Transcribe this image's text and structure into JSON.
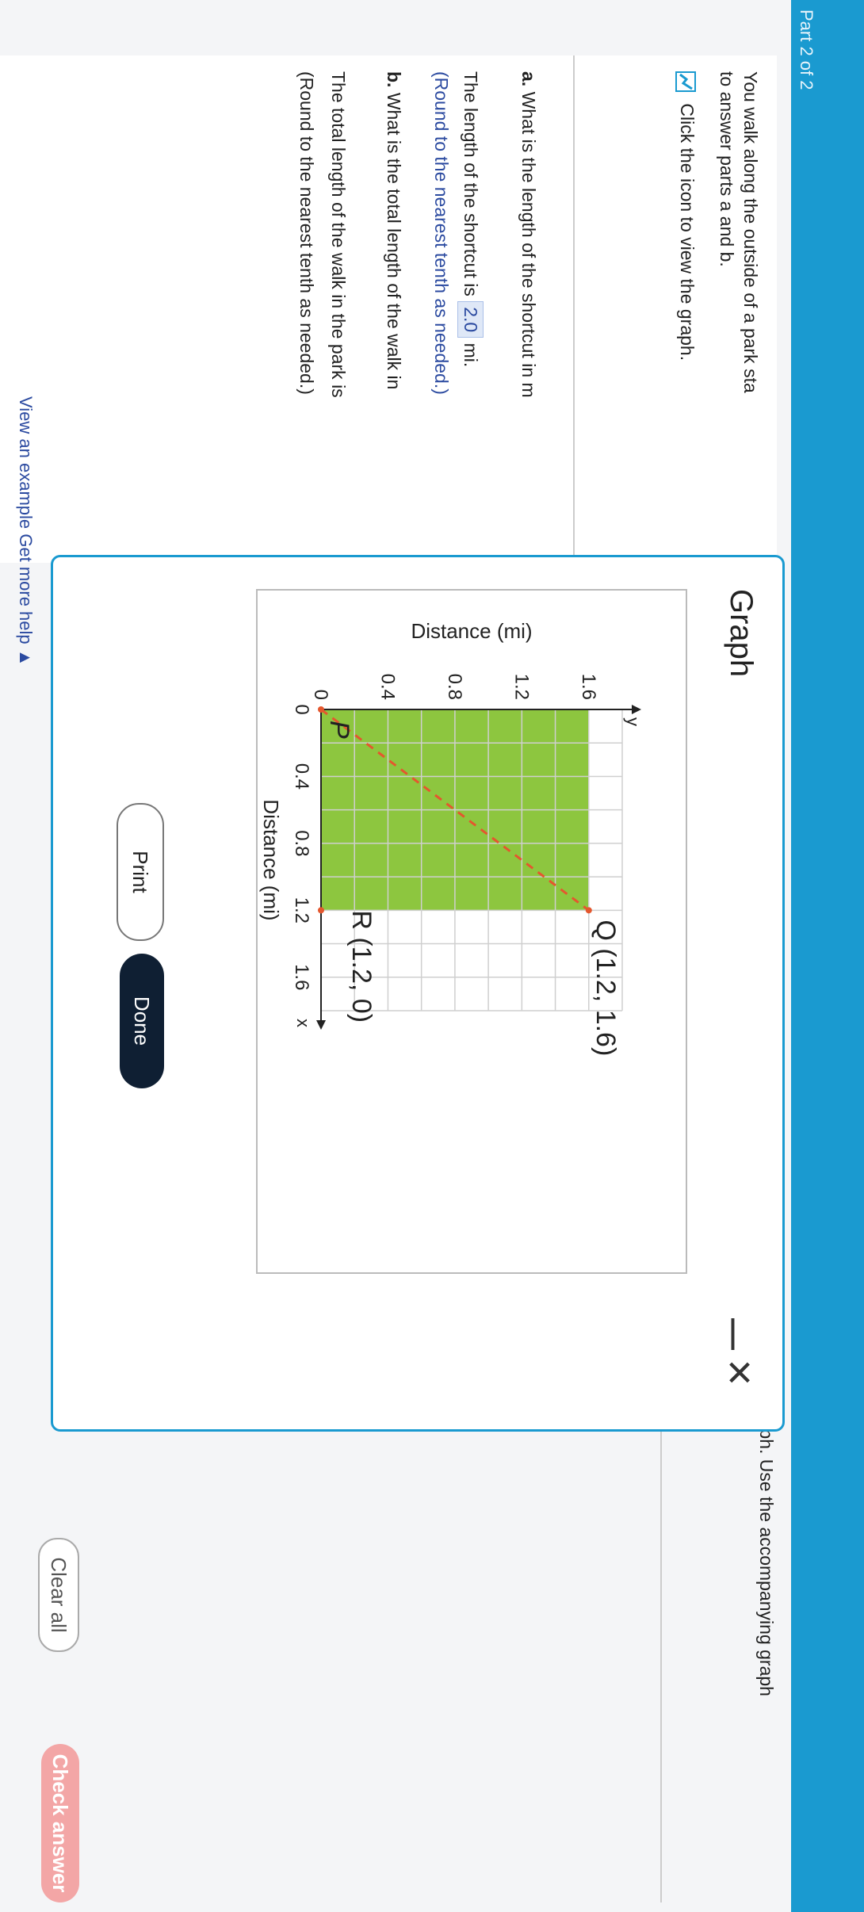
{
  "header": {
    "part_label": "Part 2 of 2"
  },
  "question": {
    "intro_line1": "You walk along the outside of a park sta",
    "intro_line2": "to answer parts a and b.",
    "icon_instruction": "Click the icon to view the graph.",
    "part_a_label": "a.",
    "part_a_text": "What is the length of the shortcut in m",
    "part_a_answer_prefix": "The length of the shortcut is",
    "part_a_answer_value": "2.0",
    "part_a_answer_unit": "mi.",
    "part_a_round": "(Round to the nearest tenth as needed.)",
    "part_b_label": "b.",
    "part_b_text": "What is the total length of the walk in",
    "part_b_answer_prefix": "The total length of the walk in the park is",
    "part_b_round": "(Round to the nearest tenth as needed.)"
  },
  "right_text": {
    "line": "e graph. Use the accompanying graph"
  },
  "modal": {
    "title": "Graph",
    "minimize_symbol": "—",
    "close_symbol": "✕",
    "print_label": "Print",
    "done_label": "Done"
  },
  "chart_data": {
    "type": "scatter",
    "xlabel": "Distance (mi)",
    "ylabel": "Distance (mi)",
    "x_axis_letter": "x",
    "y_axis_letter": "y",
    "xlim": [
      0,
      1.8
    ],
    "ylim": [
      0,
      1.8
    ],
    "xticks": [
      "0",
      "0.4",
      "0.8",
      "1.2",
      "1.6"
    ],
    "xtick_values": [
      0,
      0.4,
      0.8,
      1.2,
      1.6
    ],
    "yticks": [
      "0",
      "0.4",
      "0.8",
      "1.2",
      "1.6"
    ],
    "ytick_values": [
      0,
      0.4,
      0.8,
      1.2,
      1.6
    ],
    "grid": true,
    "grid_step": 0.2,
    "points": [
      {
        "name": "P",
        "label": "P",
        "x": 0,
        "y": 0
      },
      {
        "name": "Q",
        "label": "Q (1.2, 1.6)",
        "x": 1.2,
        "y": 1.6
      },
      {
        "name": "R",
        "label": "R (1.2, 0)",
        "x": 1.2,
        "y": 0
      }
    ],
    "shaded_region": {
      "x": [
        0,
        1.2
      ],
      "y": [
        0,
        1.6
      ],
      "color": "#8dc63f"
    },
    "shortcut": {
      "from": "P",
      "to": "Q",
      "color": "#e4572e",
      "style": "dashed"
    }
  },
  "footer": {
    "clear_label": "Clear all",
    "check_label": "Check answer",
    "help_link": "View an example   Get more help ▲"
  }
}
